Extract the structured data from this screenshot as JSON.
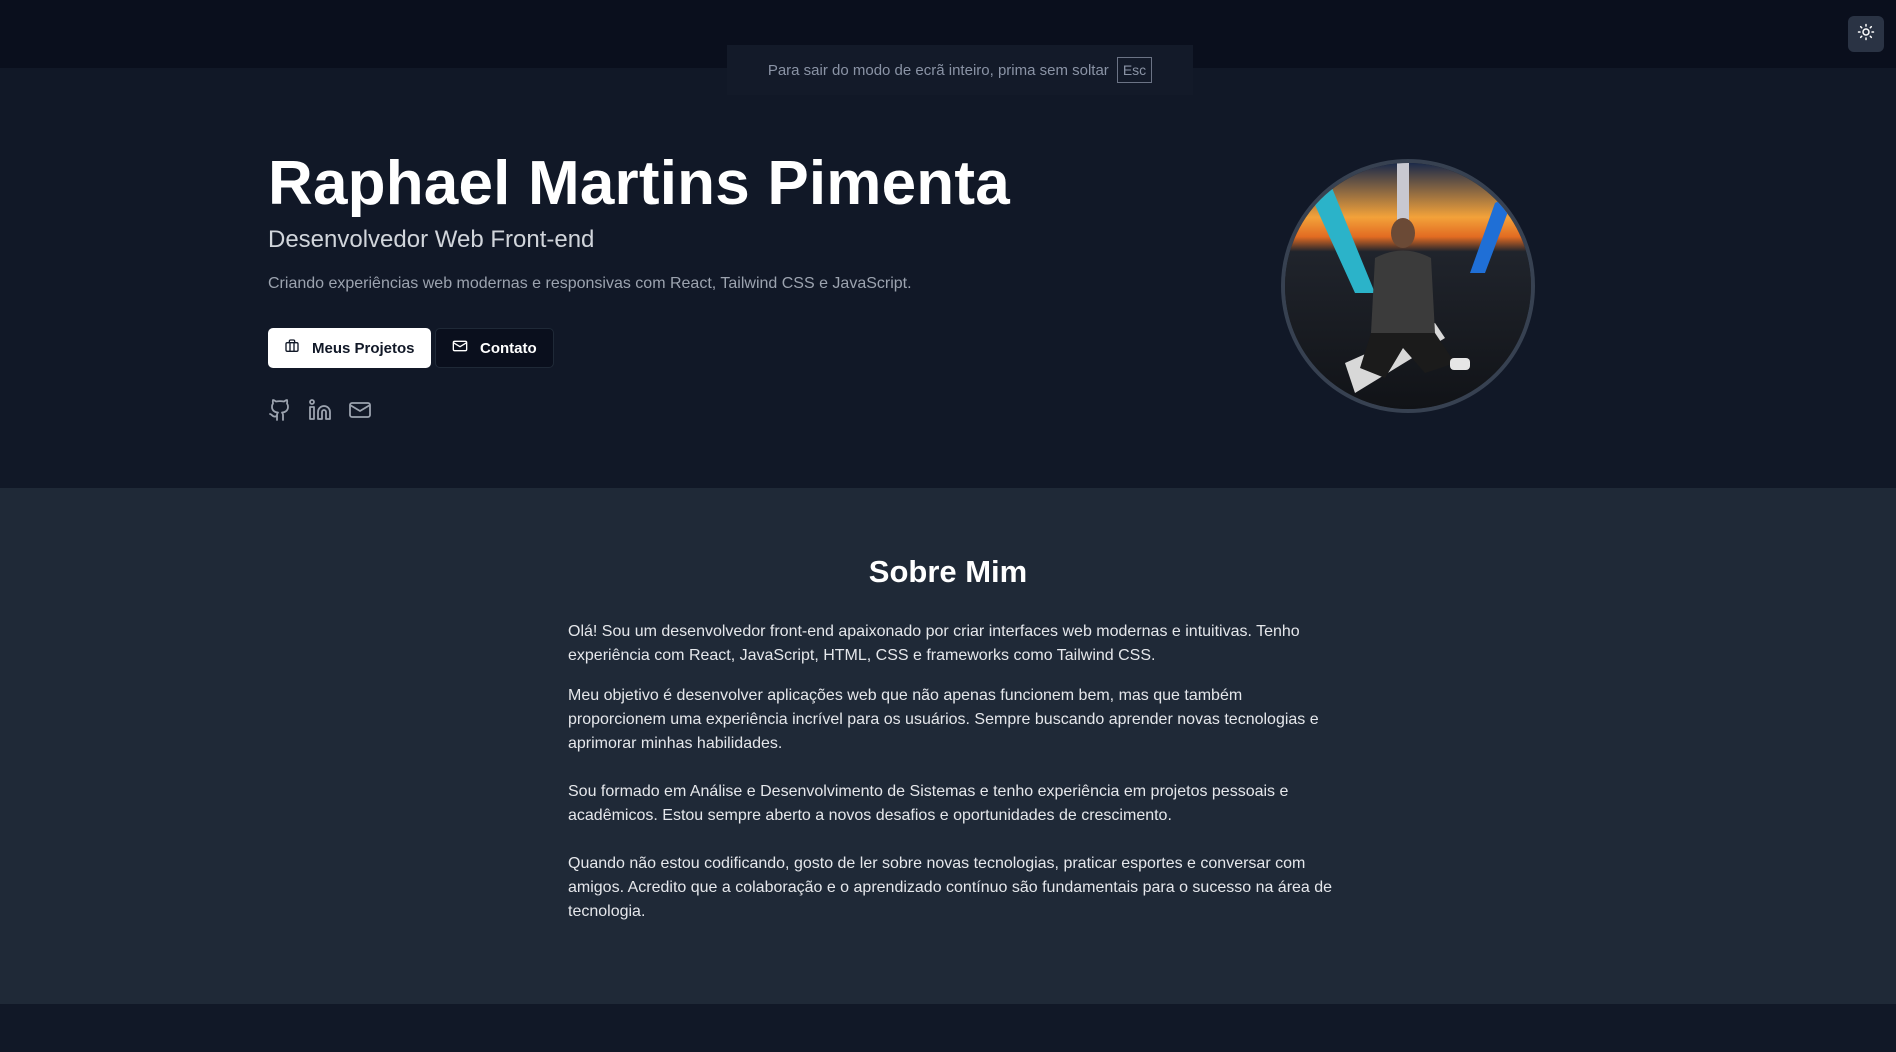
{
  "fullscreen_notice": {
    "text": "Para sair do modo de ecrã inteiro, prima sem soltar",
    "key": "Esc"
  },
  "header": {
    "theme_toggle_icon": "sun-icon"
  },
  "hero": {
    "name": "Raphael Martins Pimenta",
    "role": "Desenvolvedor Web Front-end",
    "description": "Criando experiências web modernas e responsivas com React, Tailwind CSS e JavaScript.",
    "buttons": [
      {
        "label": "Meus Projetos",
        "icon": "briefcase-icon"
      },
      {
        "label": "Contato",
        "icon": "mail-icon"
      }
    ],
    "socials": [
      "github-icon",
      "linkedin-icon",
      "mail-icon"
    ]
  },
  "about": {
    "title": "Sobre Mim",
    "paragraphs": [
      "Olá! Sou um desenvolvedor front-end apaixonado por criar interfaces web modernas e intuitivas. Tenho experiência com React, JavaScript, HTML, CSS e frameworks como Tailwind CSS.",
      "Meu objetivo é desenvolver aplicações web que não apenas funcionem bem, mas que também proporcionem uma experiência incrível para os usuários. Sempre buscando aprender novas tecnologias e aprimorar minhas habilidades.",
      "Sou formado em Análise e Desenvolvimento de Sistemas e tenho experiência em projetos pessoais e acadêmicos. Estou sempre aberto a novos desafios e oportunidades de crescimento.",
      "Quando não estou codificando, gosto de ler sobre novas tecnologias, praticar esportes e conversar com amigos. Acredito que a colaboração e o aprendizado contínuo são fundamentais para o sucesso na área de tecnologia."
    ]
  },
  "colors": {
    "page_bg": "#111827",
    "section_alt_bg": "#1f2937",
    "header_bg": "#0a0f1d",
    "primary_button_bg": "#ffffff"
  }
}
